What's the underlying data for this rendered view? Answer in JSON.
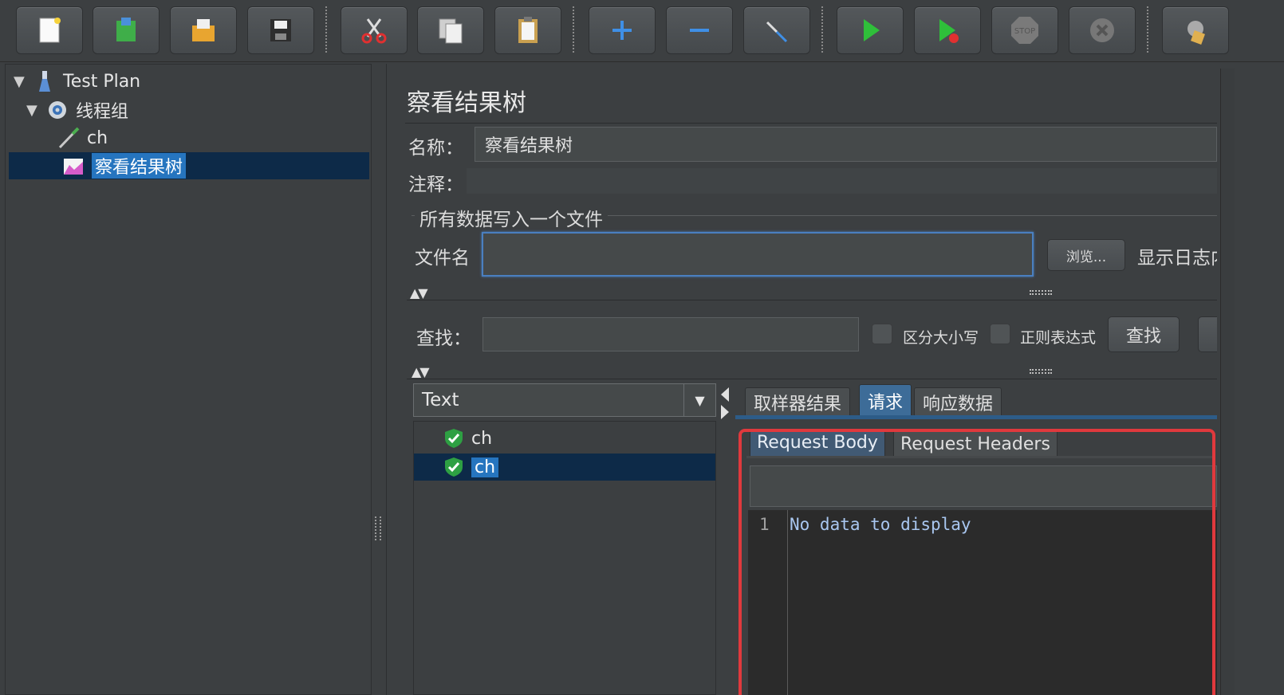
{
  "toolbar": {
    "buttons": [
      {
        "icon": "new-file-icon"
      },
      {
        "icon": "templates-icon"
      },
      {
        "icon": "open-icon"
      },
      {
        "icon": "save-icon"
      },
      {
        "icon": "cut-icon"
      },
      {
        "icon": "copy-icon"
      },
      {
        "icon": "paste-icon"
      },
      {
        "icon": "expand-icon"
      },
      {
        "icon": "collapse-icon"
      },
      {
        "icon": "toggle-icon"
      },
      {
        "icon": "start-icon"
      },
      {
        "icon": "start-no-pause-icon"
      },
      {
        "icon": "stop-icon"
      },
      {
        "icon": "shutdown-icon"
      },
      {
        "icon": "clear-all-icon"
      }
    ],
    "stop_text": "STOP"
  },
  "tree": {
    "items": [
      {
        "label": "Test Plan",
        "icon": "flask-icon"
      },
      {
        "label": "线程组",
        "icon": "gear-icon"
      },
      {
        "label": "ch",
        "icon": "sampler-pen-icon"
      },
      {
        "label": "察看结果树",
        "icon": "results-tree-icon",
        "selected": true
      }
    ]
  },
  "panel": {
    "title": "察看结果树",
    "name_label": "名称：",
    "name_value": "察看结果树",
    "comment_label": "注释：",
    "comment_value": "",
    "file_group_title": "所有数据写入一个文件",
    "filename_label": "文件名",
    "filename_value": "",
    "browse_label": "浏览...",
    "log_label": "显示日志内容"
  },
  "search": {
    "label": "查找：",
    "value": "",
    "case_label": "区分大小写",
    "regex_label": "正则表达式",
    "find_button": "查找"
  },
  "renderer": {
    "selected": "Text"
  },
  "results": [
    {
      "label": "ch",
      "status": "success",
      "icon": "success-shield-icon"
    },
    {
      "label": "ch",
      "status": "success",
      "icon": "success-shield-icon",
      "selected": true
    }
  ],
  "tabs": [
    {
      "label": "取样器结果",
      "active": false
    },
    {
      "label": "请求",
      "active": true
    },
    {
      "label": "响应数据",
      "active": false
    }
  ],
  "subtabs": [
    {
      "label": "Request Body",
      "active": true
    },
    {
      "label": "Request Headers",
      "active": false
    }
  ],
  "editor": {
    "line_number": "1",
    "content": "No data to display"
  },
  "colors": {
    "highlight": "#e0393d",
    "selection": "#2675bf",
    "active_tab": "#3d6c98"
  }
}
